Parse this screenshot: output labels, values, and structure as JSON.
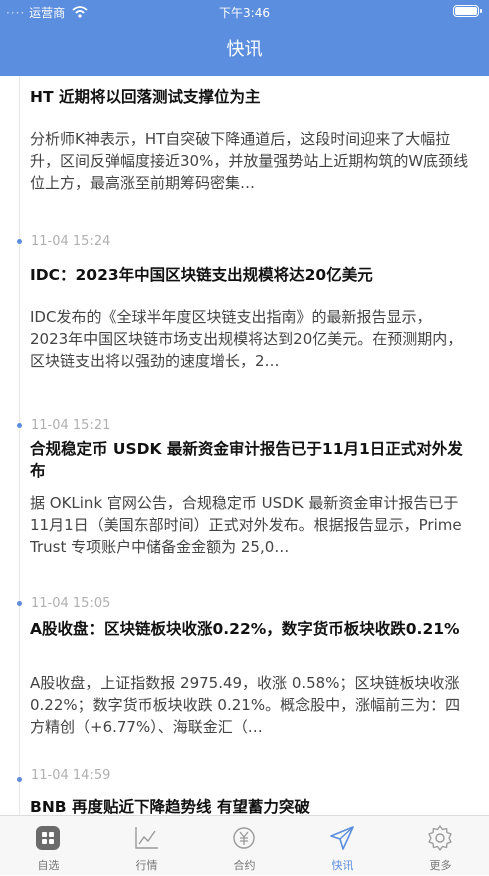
{
  "status_bar": {
    "carrier": "运营商",
    "time": "下午3:46",
    "battery_level": 1.0
  },
  "nav": {
    "title": "快讯"
  },
  "feed": {
    "items": [
      {
        "time": "",
        "headline": "HT 近期将以回落测试支撑位为主",
        "summary": "分析师K神表示，HT自突破下降通道后，这段时间迎来了大幅拉升，区间反弹幅度接近30%，并放量强势站上近期构筑的W底颈线位上方，最高涨至前期筹码密集…"
      },
      {
        "time": "11-04 15:24",
        "headline": "IDC：2023年中国区块链支出规模将达20亿美元",
        "summary": "IDC发布的《全球半年度区块链支出指南》的最新报告显示， 2023年中国区块链市场支出规模将达到20亿美元。在预测期内，区块链支出将以强劲的速度增长，2…"
      },
      {
        "time": "11-04 15:21",
        "headline": "合规稳定币 USDK 最新资金审计报告已于11月1日正式对外发布",
        "summary": "据 OKLink 官网公告，合规稳定币 USDK 最新资金审计报告已于11月1日（美国东部时间）正式对外发布。根据报告显示，Prime Trust 专项账户中储备金金额为 25,0…"
      },
      {
        "time": "11-04 15:05",
        "headline": "A股收盘：区块链板块收涨0.22%，数字货币板块收跌0.21%",
        "summary": "A股收盘，上证指数报 2975.49，收涨 0.58%；区块链板块收涨 0.22%；数字货币板块收跌 0.21%。概念股中，涨幅前三为：四方精创（+6.77%）、海联金汇（…"
      },
      {
        "time": "11-04 14:59",
        "headline": "BNB 再度贴近下降趋势线 有望蓄力突破",
        "summary": ""
      }
    ]
  },
  "tabs": [
    {
      "label": "自选",
      "icon": "grid-icon"
    },
    {
      "label": "行情",
      "icon": "chart-icon"
    },
    {
      "label": "合约",
      "icon": "yuan-coin-icon"
    },
    {
      "label": "快讯",
      "icon": "send-icon",
      "active": true
    },
    {
      "label": "更多",
      "icon": "gear-icon"
    }
  ],
  "colors": {
    "accent": "#5b8ede"
  }
}
